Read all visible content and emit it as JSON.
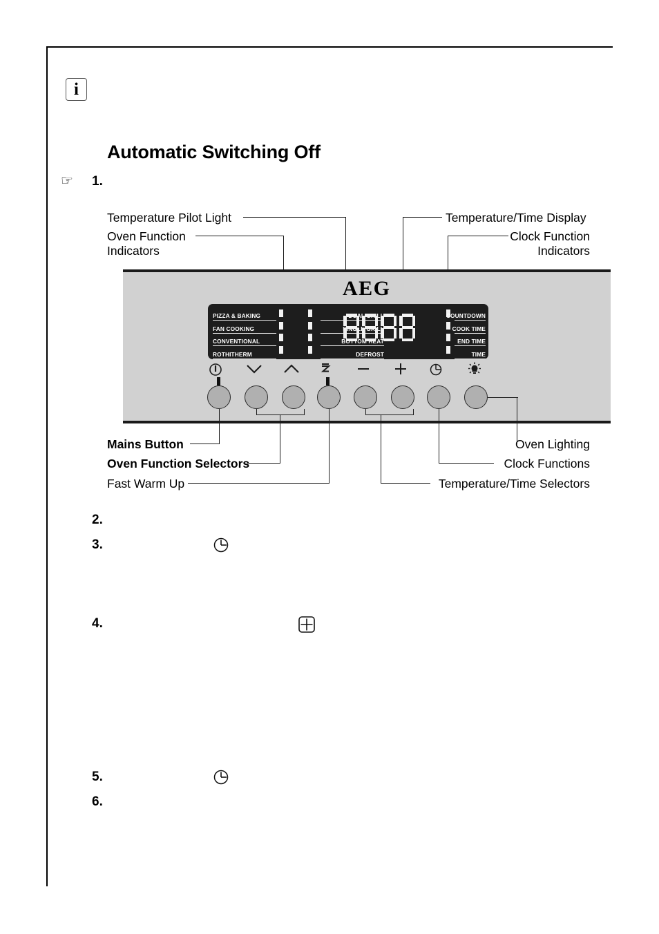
{
  "page": {
    "info_icon_glyph": "i",
    "hand_icon_glyph": "☞",
    "heading": "Automatic Switching Off"
  },
  "steps": [
    {
      "num": "1."
    },
    {
      "num": "2."
    },
    {
      "num": "3.",
      "icon": "clock-icon"
    },
    {
      "num": "4.",
      "icon": "plus-square-icon"
    },
    {
      "num": "5.",
      "icon": "clock-icon"
    },
    {
      "num": "6."
    }
  ],
  "diagram": {
    "brand": "AEG",
    "callouts_top_left": [
      {
        "label": "Temperature Pilot Light"
      },
      {
        "label": "Oven Function"
      },
      {
        "label": "Indicators"
      }
    ],
    "callouts_top_right": [
      {
        "label": "Temperature/Time Display"
      },
      {
        "label": "Clock Function"
      },
      {
        "label": "Indicators"
      }
    ],
    "callouts_bottom_left": [
      {
        "label": "Mains Button",
        "bold": true
      },
      {
        "label": "Oven Function Selectors",
        "bold": true
      },
      {
        "label": "Fast Warm Up",
        "bold": false
      }
    ],
    "callouts_bottom_right": [
      {
        "label": "Oven Lighting"
      },
      {
        "label": "Clock Functions"
      },
      {
        "label": "Temperature/Time Selectors"
      }
    ],
    "oven_functions_left": [
      "PIZZA & BAKING",
      "FAN COOKING",
      "CONVENTIONAL",
      "ROTHITHERM"
    ],
    "oven_functions_right": [
      "DUAL GRILL",
      "SINGLE GRILL",
      "BOTTOM HEAT",
      "DEFROST"
    ],
    "clock_functions": [
      "COUNTDOWN",
      "COOK TIME",
      "END TIME",
      "TIME"
    ],
    "display_value": "8888",
    "buttons": [
      {
        "name": "mains-button",
        "icon": "power-icon"
      },
      {
        "name": "function-down-button",
        "icon": "chevron-down-icon"
      },
      {
        "name": "function-up-button",
        "icon": "chevron-up-icon"
      },
      {
        "name": "fast-warm-up-button",
        "icon": "fast-warm-up-icon"
      },
      {
        "name": "temperature-minus-button",
        "icon": "minus-icon"
      },
      {
        "name": "temperature-plus-button",
        "icon": "plus-icon"
      },
      {
        "name": "clock-functions-button",
        "icon": "clock-icon"
      },
      {
        "name": "oven-lighting-button",
        "icon": "lamp-icon"
      }
    ],
    "colors": {
      "panel": "#d1d1d1",
      "module": "#1d1d1d",
      "led": "#f2f2f2",
      "button": "#b0b0b0"
    }
  }
}
